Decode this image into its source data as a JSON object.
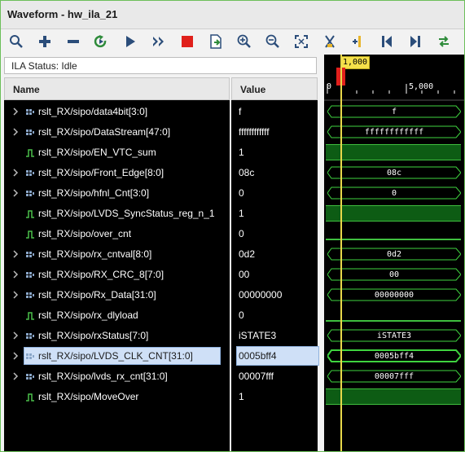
{
  "window": {
    "title": "Waveform - hw_ila_21"
  },
  "toolbar": {
    "buttons": [
      {
        "name": "search-icon"
      },
      {
        "name": "add-icon"
      },
      {
        "name": "remove-icon"
      },
      {
        "name": "run-trigger-immediate-icon"
      },
      {
        "name": "run-trigger-icon"
      },
      {
        "name": "run-continuous-icon"
      },
      {
        "name": "stop-icon"
      },
      {
        "name": "export-icon"
      },
      {
        "name": "zoom-in-icon"
      },
      {
        "name": "zoom-out-icon"
      },
      {
        "name": "zoom-fit-icon"
      },
      {
        "name": "toggle-markers-icon"
      },
      {
        "name": "add-marker-icon"
      },
      {
        "name": "go-to-start-icon"
      },
      {
        "name": "go-to-end-icon"
      },
      {
        "name": "swap-icon"
      }
    ]
  },
  "status": {
    "text": "ILA Status:  Idle"
  },
  "columns": {
    "name": "Name",
    "value": "Value"
  },
  "cursor": {
    "label": "1,000"
  },
  "timescale": {
    "start": "0",
    "mark": "5,000"
  },
  "signals": [
    {
      "name": "rslt_RX/sipo/data4bit[3:0]",
      "value": "f",
      "kind": "bus",
      "wave": "f"
    },
    {
      "name": "rslt_RX/sipo/DataStream[47:0]",
      "value": "ffffffffffff",
      "kind": "bus",
      "wave": "ffffffffffff"
    },
    {
      "name": "rslt_RX/sipo/EN_VTC_sum",
      "value": "1",
      "kind": "bit",
      "wave": ""
    },
    {
      "name": "rslt_RX/sipo/Front_Edge[8:0]",
      "value": "08c",
      "kind": "bus",
      "wave": "08c"
    },
    {
      "name": "rslt_RX/sipo/hfnl_Cnt[3:0]",
      "value": "0",
      "kind": "bus",
      "wave": "0"
    },
    {
      "name": "rslt_RX/sipo/LVDS_SyncStatus_reg_n_1",
      "value": "1",
      "kind": "bit",
      "wave": ""
    },
    {
      "name": "rslt_RX/sipo/over_cnt",
      "value": "0",
      "kind": "bit0",
      "wave": ""
    },
    {
      "name": "rslt_RX/sipo/rx_cntval[8:0]",
      "value": "0d2",
      "kind": "bus",
      "wave": "0d2"
    },
    {
      "name": "rslt_RX/sipo/RX_CRC_8[7:0]",
      "value": "00",
      "kind": "bus",
      "wave": "00"
    },
    {
      "name": "rslt_RX/sipo/Rx_Data[31:0]",
      "value": "00000000",
      "kind": "bus",
      "wave": "00000000"
    },
    {
      "name": "rslt_RX/sipo/rx_dlyload",
      "value": "0",
      "kind": "bit0",
      "wave": ""
    },
    {
      "name": "rslt_RX/sipo/rxStatus[7:0]",
      "value": "iSTATE3",
      "kind": "bus",
      "wave": "iSTATE3"
    },
    {
      "name": "rslt_RX/sipo/LVDS_CLK_CNT[31:0]",
      "value": "0005bff4",
      "kind": "bus",
      "wave": "0005bff4",
      "selected": true
    },
    {
      "name": "rslt_RX/sipo/lvds_rx_cnt[31:0]",
      "value": "00007fff",
      "kind": "bus",
      "wave": "00007fff"
    },
    {
      "name": "rslt_RX/sipo/MoveOver",
      "value": "1",
      "kind": "bit",
      "wave": ""
    }
  ]
}
